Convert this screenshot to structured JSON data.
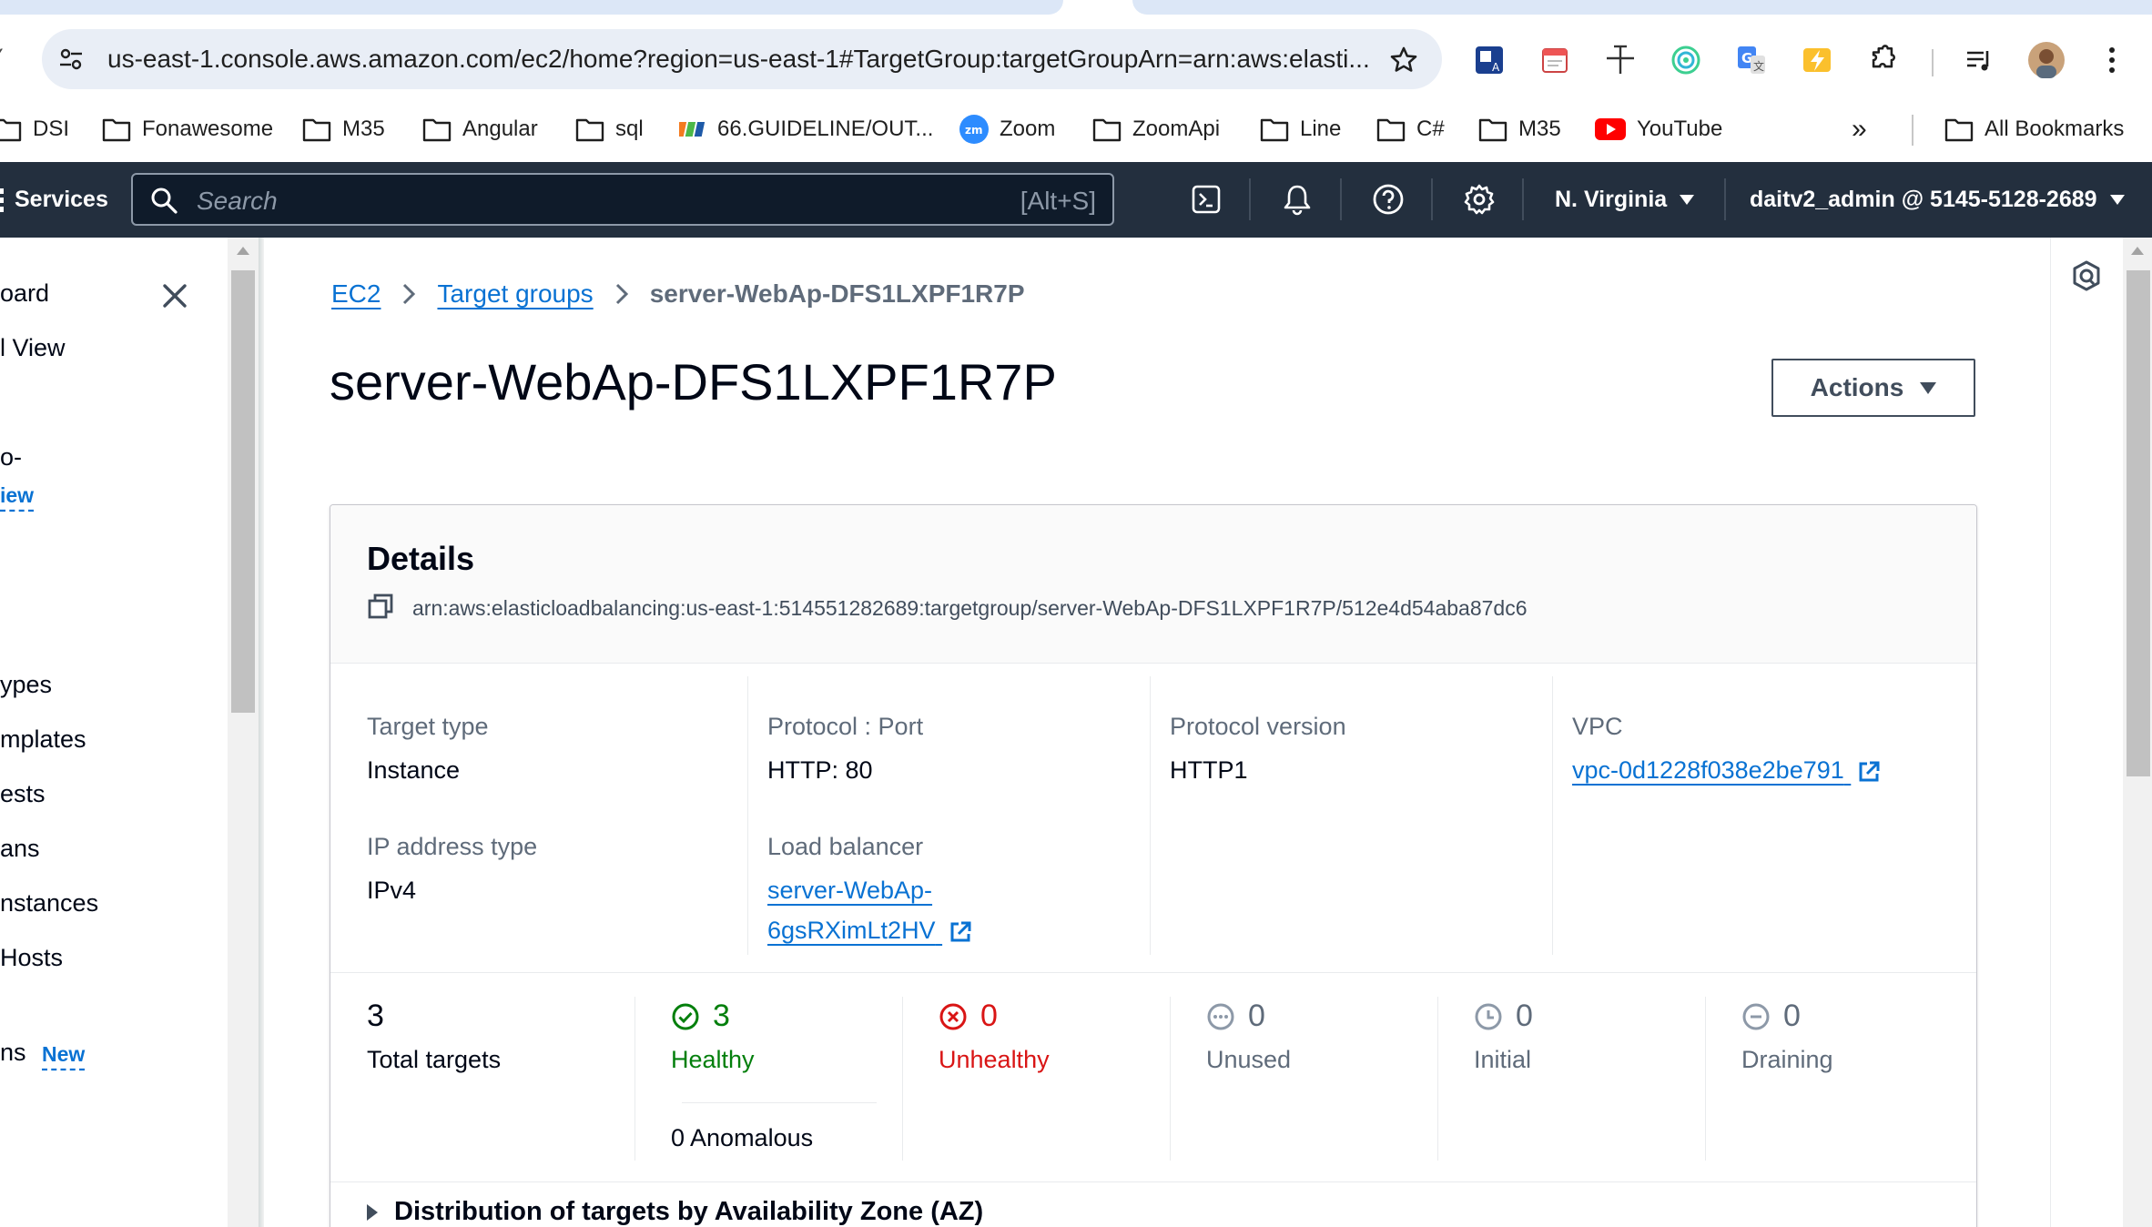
{
  "browser": {
    "url": "us-east-1.console.aws.amazon.com/ec2/home?region=us-east-1#TargetGroup:targetGroupArn=arn:aws:elasti...",
    "bookmarks": [
      {
        "label": "DSI",
        "icon": "folder-icon"
      },
      {
        "label": "Fonawesome",
        "icon": "folder-icon"
      },
      {
        "label": "M35",
        "icon": "folder-icon"
      },
      {
        "label": "Angular",
        "icon": "folder-icon"
      },
      {
        "label": "sql",
        "icon": "folder-icon"
      },
      {
        "label": "66.GUIDELINE/OUT...",
        "icon": "fpt-logo-icon"
      },
      {
        "label": "Zoom",
        "icon": "zoom-logo-icon"
      },
      {
        "label": "ZoomApi",
        "icon": "folder-icon"
      },
      {
        "label": "Line",
        "icon": "folder-icon"
      },
      {
        "label": "C#",
        "icon": "folder-icon"
      },
      {
        "label": "M35",
        "icon": "folder-icon"
      },
      {
        "label": "YouTube",
        "icon": "youtube-logo-icon"
      }
    ],
    "more_bookmarks": "»",
    "all_bookmarks": "All Bookmarks"
  },
  "aws_nav": {
    "services": "Services",
    "search_placeholder": "Search",
    "search_shortcut": "[Alt+S]",
    "region": "N. Virginia",
    "account": "daitv2_admin @ 5145-5128-2689"
  },
  "side_nav": {
    "items": [
      "oard",
      "l View",
      "o-",
      "iew",
      "ypes",
      "mplates",
      "ests",
      "ans",
      "nstances",
      " Hosts",
      "ns"
    ],
    "new_badge": "New"
  },
  "breadcrumb": {
    "items": [
      "EC2",
      "Target groups"
    ],
    "current": "server-WebAp-DFS1LXPF1R7P"
  },
  "page": {
    "title": "server-WebAp-DFS1LXPF1R7P",
    "actions_label": "Actions"
  },
  "details": {
    "heading": "Details",
    "arn": "arn:aws:elasticloadbalancing:us-east-1:514551282689:targetgroup/server-WebAp-DFS1LXPF1R7P/512e4d54aba87dc6",
    "target_type_label": "Target type",
    "target_type": "Instance",
    "protocol_port_label": "Protocol : Port",
    "protocol_port": "HTTP: 80",
    "protocol_version_label": "Protocol version",
    "protocol_version": "HTTP1",
    "vpc_label": "VPC",
    "vpc": "vpc-0d1228f038e2be791",
    "ip_type_label": "IP address type",
    "ip_type": "IPv4",
    "lb_label": "Load balancer",
    "lb_line1": "server-WebAp-",
    "lb_line2": "6gsRXimLt2HV"
  },
  "stats": {
    "total": "3",
    "total_label": "Total targets",
    "healthy": "3",
    "healthy_label": "Healthy",
    "anomalous": "0 Anomalous",
    "unhealthy": "0",
    "unhealthy_label": "Unhealthy",
    "unused": "0",
    "unused_label": "Unused",
    "initial": "0",
    "initial_label": "Initial",
    "draining": "0",
    "draining_label": "Draining"
  },
  "distribution_label": "Distribution of targets by Availability Zone (AZ)",
  "colors": {
    "aws_nav_bg": "#232f3e",
    "link": "#0972d3",
    "healthy": "#037f0c",
    "unhealthy": "#d91515",
    "muted": "#5f6b7a"
  }
}
